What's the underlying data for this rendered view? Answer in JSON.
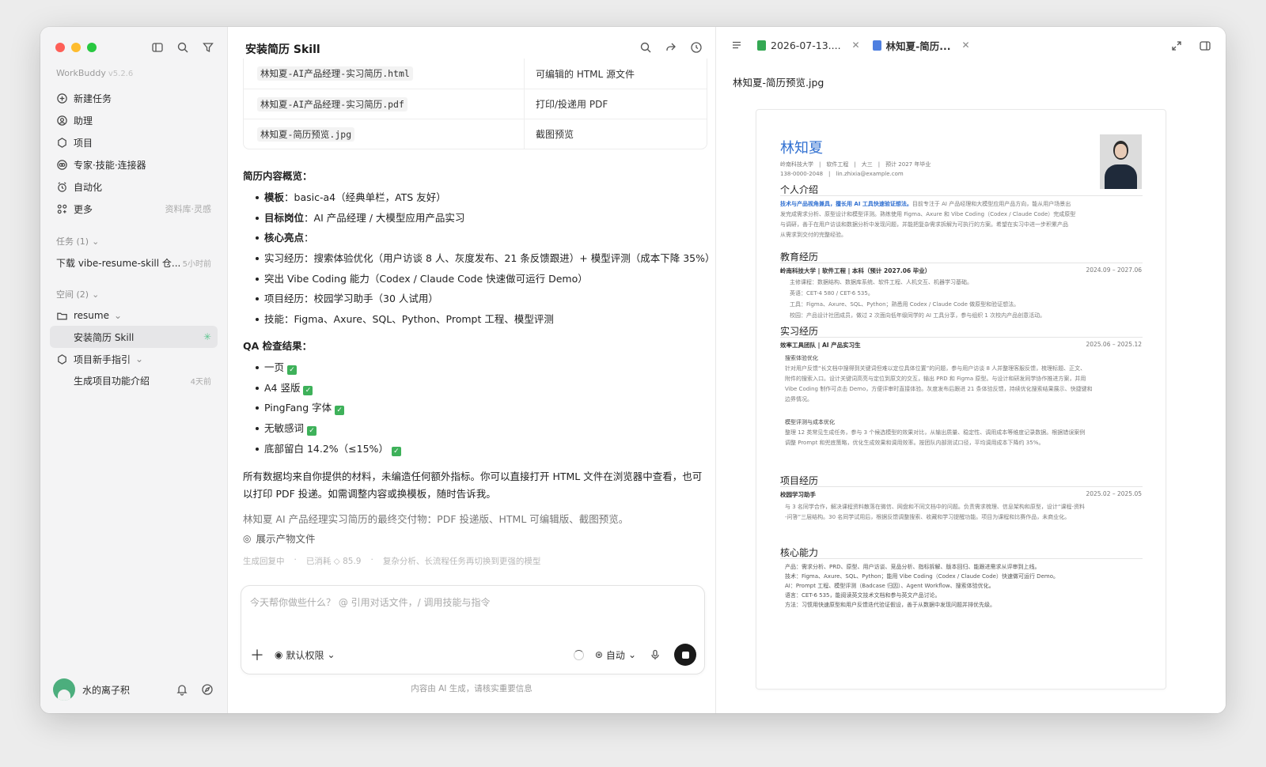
{
  "app": {
    "name": "WorkBuddy",
    "version": "v5.2.6"
  },
  "sidebar": {
    "nav": [
      {
        "label": "新建任务"
      },
      {
        "label": "助理"
      },
      {
        "label": "项目"
      },
      {
        "label": "专家·技能·连接器"
      },
      {
        "label": "自动化"
      },
      {
        "label": "更多",
        "right": "资料库·灵感"
      }
    ],
    "tasks_label": "任务 (1)",
    "task": {
      "label": "下载 vibe-resume-skill 仓...",
      "time": "5小时前"
    },
    "spaces_label": "空间 (2)",
    "space_resume": "resume",
    "active_item": "安装简历 Skill",
    "project_guide": "项目新手指引",
    "sub_item": {
      "label": "生成项目功能介绍",
      "time": "4天前"
    },
    "user": {
      "name": "水的离子积"
    }
  },
  "chat": {
    "title": "安装简历 Skill",
    "files": [
      {
        "name": "林知夏-AI产品经理-实习简历.html",
        "desc": "可编辑的 HTML 源文件"
      },
      {
        "name": "林知夏-AI产品经理-实习简历.pdf",
        "desc": "打印/投递用 PDF"
      },
      {
        "name": "林知夏-简历预览.jpg",
        "desc": "截图预览"
      }
    ],
    "overview_heading": "简历内容概览：",
    "overview": [
      {
        "k": "模板",
        "v": "：basic-a4（经典单栏，ATS 友好）"
      },
      {
        "k": "目标岗位",
        "v": "：AI 产品经理 / 大模型应用产品实习"
      },
      {
        "k": "核心亮点",
        "v": "："
      },
      {
        "k": "",
        "v": "实习经历：搜索体验优化（用户访谈 8 人、灰度发布、21 条反馈跟进）+ 模型评测（成本下降 35%）"
      },
      {
        "k": "",
        "v": "突出 Vibe Coding 能力（Codex / Claude Code 快速做可运行 Demo）"
      },
      {
        "k": "",
        "v": "项目经历：校园学习助手（30 人试用）"
      },
      {
        "k": "",
        "v": "技能：Figma、Axure、SQL、Python、Prompt 工程、模型评测"
      }
    ],
    "qa_heading": "QA 检查结果：",
    "qa": [
      "一页",
      "A4 竖版",
      "PingFang 字体",
      "无敏感词",
      "底部留白 14.2%（≤15%）"
    ],
    "summary": "所有数据均来自你提供的材料，未编造任何额外指标。你可以直接打开 HTML 文件在浏览器中查看，也可以打印 PDF 投递。如需调整内容或换模板，随时告诉我。",
    "deliverable": "林知夏 AI 产品经理实习简历的最终交付物：PDF 投递版、HTML 可编辑版、截图预览。",
    "show_files": "展示产物文件",
    "status": {
      "generating": "生成回复中",
      "consumed": "已消耗 ◇ 85.9",
      "hint": "复杂分析、长流程任务再切换到更强的模型"
    },
    "composer": {
      "placeholder": "今天帮你做些什么？ @ 引用对话文件，/ 调用技能与指令",
      "permission": "默认权限",
      "mode": "自动"
    },
    "disclaimer": "内容由 AI 生成，请核实重要信息"
  },
  "preview": {
    "tabs": [
      {
        "label": "2026-07-13...."
      },
      {
        "label": "林知夏-简历..."
      }
    ],
    "title": "林知夏-简历预览.jpg",
    "resume": {
      "name": "林知夏",
      "meta1": "岭南科技大学　|　软件工程　|　大三　|　预计 2027 年毕业",
      "meta2": "138-0000-2048　|　lin.zhixia@example.com",
      "s1": "个人介绍",
      "intro_hl": "技术与产品视角兼具，擅长用 AI 工具快速验证想法。",
      "intro1": "目前专注于 AI 产品经理和大模型应用产品方向，能从用户场景出",
      "intro2": "发完成需求分析、原型设计和模型评测。熟练使用 Figma、Axure 和 Vibe Coding（Codex / Claude Code）完成原型",
      "intro3": "与调研，善于在用户访谈和数据分析中发现问题，并能把复杂需求拆解为可执行的方案。希望在实习中进一步积累产品",
      "intro4": "从需求到交付的完整经验。",
      "s2": "教育经历",
      "edu_head": "岭南科技大学 | 软件工程 | 本科（预计 2027.06 毕业）",
      "edu_date": "2024.09 – 2027.06",
      "edu1": "主修课程：数据结构、数据库系统、软件工程、人机交互、机器学习基础。",
      "edu2": "英语：CET-4 580 / CET-6 535。",
      "edu3": "工具：Figma、Axure、SQL、Python；熟悉用 Codex / Claude Code 做原型和验证想法。",
      "edu4": "校园：产品设计社团成员，做过 2 次面向低年级同学的 AI 工具分享，参与组织 1 次校内产品创意活动。",
      "s3": "实习经历",
      "intern_head": "效率工具团队 | AI 产品实习生",
      "intern_date": "2025.06 – 2025.12",
      "intern_t1": "搜索体验优化",
      "intern1": "针对用户反馈“长文档中搜得到关键词但难以定位具体位置”的问题，参与用户访谈 8 人并整理客服反馈，梳理标题、正文、",
      "intern2": "附件的搜索入口。设计关键词高亮与定位到原文的交互，输出 PRD 和 Figma 原型。与设计和研发同学协作推进方案，并用",
      "intern3": "Vibe Coding 制作可点击 Demo，方便评审时直接体验。灰度发布后跟进 21 条体验反馈，持续优化搜索结果展示、快捷键和",
      "intern4": "边界情况。",
      "intern_t2": "模型评测与成本优化",
      "intern5": "整理 12 类常见生成任务，参与 3 个候选模型的效果对比，从输出质量、稳定性、调用成本等维度记录数据。根据错误案例",
      "intern6": "调整 Prompt 和兜底策略，优化生成效果和调用效率。按团队内部测试口径，平均调用成本下降约 35%。",
      "s4": "项目经历",
      "proj_head": "校园学习助手",
      "proj_date": "2025.02 – 2025.05",
      "proj1": "与 3 名同学合作，解决课程资料散落在微信、网盘和不同文档中的问题。负责需求梳理、信息架构和原型，设计“课程-资料",
      "proj2": "-问答”三层结构。30 名同学试用后，根据反馈调整搜索、收藏和学习提醒功能。项目为课程和比赛作品，未商业化。",
      "s5": "核心能力",
      "sk1": "产品：需求分析、PRD、原型、用户访谈、竞品分析、指标拆解、版本回归、能跟进需求从评审到上线。",
      "sk2": "技术：Figma、Axure、SQL、Python；能用 Vibe Coding（Codex / Claude Code）快速做可运行 Demo。",
      "sk3": "AI：Prompt 工程、模型评测（Badcase 归因）、Agent Workflow、搜索体验优化。",
      "sk4": "语言：CET-6 535，能阅读英文技术文档和参与英文产品讨论。",
      "sk5": "方法：习惯用快速原型和用户反馈迭代验证假设，善于从数据中发现问题并排优先级。"
    }
  }
}
